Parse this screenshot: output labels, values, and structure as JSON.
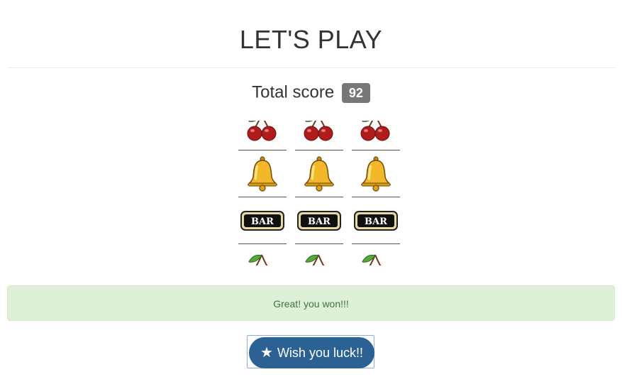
{
  "header": {
    "title": "LET'S PLAY"
  },
  "score": {
    "label": "Total score",
    "value": "92"
  },
  "reels": [
    [
      "cherry",
      "bell",
      "bar",
      "cherry"
    ],
    [
      "cherry",
      "bell",
      "bar",
      "cherry"
    ],
    [
      "cherry",
      "bell",
      "bar",
      "cherry"
    ]
  ],
  "symbols": {
    "bar_text": "BAR"
  },
  "alert": {
    "message": "Great! you won!!!"
  },
  "spin_button": {
    "label": "Wish you luck!!",
    "icon": "star-icon"
  },
  "colors": {
    "button": "#2b6193",
    "alert_bg": "#dff0d8",
    "alert_text": "#3c763d",
    "badge": "#777777"
  }
}
